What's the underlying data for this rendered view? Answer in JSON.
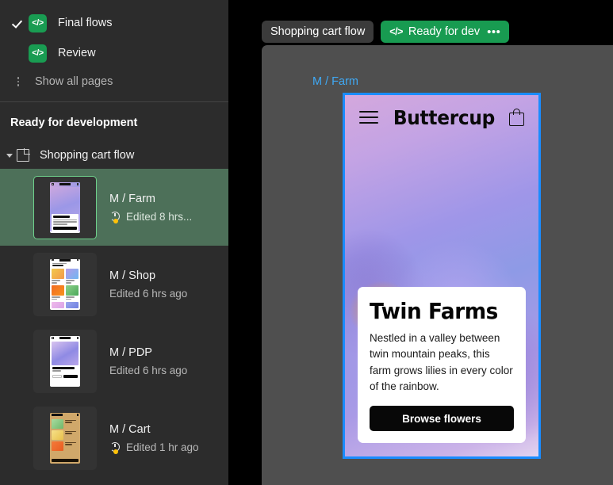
{
  "sidebar": {
    "pages": [
      {
        "label": "Final flows",
        "badge": "</>",
        "checked": true
      },
      {
        "label": "Review",
        "badge": "</>",
        "checked": false
      }
    ],
    "show_all_pages": "Show all pages",
    "section_title": "Ready for development",
    "group": {
      "label": "Shopping cart flow"
    },
    "items": [
      {
        "title": "M / Farm",
        "edited": "Edited 8 hrs...",
        "has_history_icon": true,
        "selected": true
      },
      {
        "title": "M / Shop",
        "edited": "Edited 6 hrs ago",
        "has_history_icon": false,
        "selected": false
      },
      {
        "title": "M / PDP",
        "edited": "Edited 6 hrs ago",
        "has_history_icon": false,
        "selected": false
      },
      {
        "title": "M / Cart",
        "edited": "Edited 1 hr ago",
        "has_history_icon": true,
        "selected": false
      }
    ]
  },
  "toolbar": {
    "flow_name": "Shopping cart flow",
    "status_label": "Ready for dev",
    "status_code_glyph": "</>",
    "status_more": "•••"
  },
  "canvas": {
    "frame_label": "M / Farm"
  },
  "phone": {
    "brand": "Buttercup",
    "menu_icon": "hamburger-icon",
    "cart_icon": "shopping-bag-icon",
    "card": {
      "title": "Twin Farms",
      "body": "Nestled in a valley between twin mountain peaks, this farm grows lilies in every color of the rainbow.",
      "cta": "Browse flowers"
    }
  },
  "colors": {
    "sidebar_bg": "#2c2c2c",
    "selected_row": "#4d7059",
    "status_green": "#189b51",
    "badge_green": "#199c52",
    "canvas_bg": "#4f4f4f",
    "frame_label_blue": "#3fa9f5",
    "selection_blue": "#1a8cff",
    "edited_dot": "#ffc107"
  }
}
